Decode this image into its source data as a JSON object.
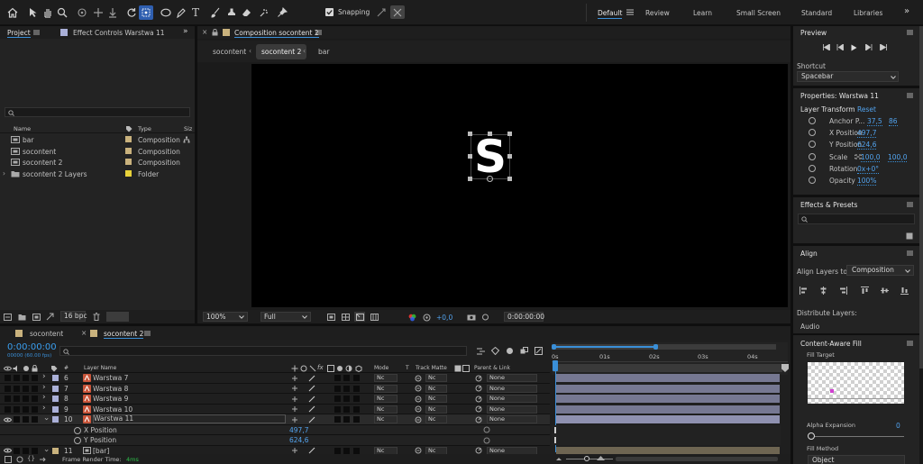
{
  "toolbar": {
    "snapping_label": "Snapping",
    "snapping_checked": true,
    "workspaces": [
      "Default",
      "Review",
      "Learn",
      "Small Screen",
      "Standard",
      "Libraries"
    ],
    "active_workspace": "Default",
    "more": "»"
  },
  "project": {
    "tab_project": "Project",
    "tab_effects": "Effect Controls Warstwa 11",
    "more": "»",
    "search_placeholder": "",
    "columns": {
      "name": "Name",
      "type": "Type",
      "size": "Siz"
    },
    "items": [
      {
        "name": "bar",
        "type": "Composition",
        "color": "#c9b27d",
        "icon": "composition-icon"
      },
      {
        "name": "socontent",
        "type": "Composition",
        "color": "#c9b27d",
        "icon": "composition-icon"
      },
      {
        "name": "socontent 2",
        "type": "Composition",
        "color": "#c9b27d",
        "icon": "composition-icon"
      },
      {
        "name": "socontent 2 Layers",
        "type": "Folder",
        "color": "#e8d23a",
        "icon": "folder-icon"
      }
    ],
    "bpc": "16 bpc"
  },
  "composition": {
    "tab_title": "Composition socontent 2",
    "breadcrumbs": [
      "socontent",
      "socontent 2",
      "bar"
    ],
    "active_breadcrumb": "socontent 2",
    "logo_text": "S",
    "zoom": "100%",
    "resolution": "Full",
    "exposure": "+0,0",
    "timecode": "0:00:00:00"
  },
  "preview": {
    "title": "Preview",
    "shortcut_label": "Shortcut",
    "shortcut_value": "Spacebar"
  },
  "properties": {
    "title": "Properties: Warstwa 11",
    "section": "Layer Transform",
    "reset": "Reset",
    "rows": [
      {
        "label": "Anchor P...",
        "v1": "37,5",
        "v2": "86"
      },
      {
        "label": "X Position",
        "v1": "497,7",
        "v2": ""
      },
      {
        "label": "Y Position",
        "v1": "624,6",
        "v2": ""
      },
      {
        "label": "Scale",
        "v1": "100,0",
        "v2": "100,0"
      },
      {
        "label": "Rotation",
        "v1": "0x+0°",
        "v2": ""
      },
      {
        "label": "Opacity",
        "v1": "100%",
        "v2": ""
      }
    ]
  },
  "effects": {
    "title": "Effects & Presets",
    "search_placeholder": ""
  },
  "align": {
    "title": "Align",
    "align_to_label": "Align Layers to:",
    "align_to_value": "Composition",
    "distribute_label": "Distribute Layers:"
  },
  "audio": {
    "title": "Audio"
  },
  "caf": {
    "title": "Content-Aware Fill",
    "fill_target": "Fill Target",
    "alpha_expansion": "Alpha Expansion",
    "alpha_value": "0",
    "fill_method": "Fill Method",
    "fill_method_value": "Object"
  },
  "timeline": {
    "tabs": [
      "socontent",
      "socontent 2"
    ],
    "active_tab": "socontent 2",
    "timecode": "0:00:00:00",
    "frame_info": "00000 (60.00 fps)",
    "search_placeholder": "",
    "headers": {
      "num": "#",
      "layer_name": "Layer Name",
      "mode": "Mode",
      "t": "T",
      "track_matte": "Track Matte",
      "parent": "Parent & Link"
    },
    "ruler": [
      "0s",
      "01s",
      "02s",
      "03s",
      "04s"
    ],
    "layers": [
      {
        "num": "6",
        "name": "Warstwa 7",
        "color": "#aab0d8",
        "mode": "Nc",
        "matte": "Nc",
        "parent": "None"
      },
      {
        "num": "7",
        "name": "Warstwa 8",
        "color": "#aab0d8",
        "mode": "Nc",
        "matte": "Nc",
        "parent": "None"
      },
      {
        "num": "8",
        "name": "Warstwa 9",
        "color": "#aab0d8",
        "mode": "Nc",
        "matte": "Nc",
        "parent": "None"
      },
      {
        "num": "9",
        "name": "Warstwa 10",
        "color": "#aab0d8",
        "mode": "Nc",
        "matte": "Nc",
        "parent": "None"
      },
      {
        "num": "10",
        "name": "Warstwa 11",
        "color": "#aab0d8",
        "mode": "Nc",
        "matte": "Nc",
        "parent": "None"
      }
    ],
    "props": [
      {
        "name": "X Position",
        "value": "497,7"
      },
      {
        "name": "Y Position",
        "value": "624,6"
      }
    ],
    "layer11": {
      "num": "11",
      "name": "[bar]",
      "color": "#c9b27d",
      "mode": "Nc",
      "matte": "Nc",
      "parent": "None"
    },
    "frame_render_label": "Frame Render Time:",
    "frame_render_value": "4ms"
  }
}
